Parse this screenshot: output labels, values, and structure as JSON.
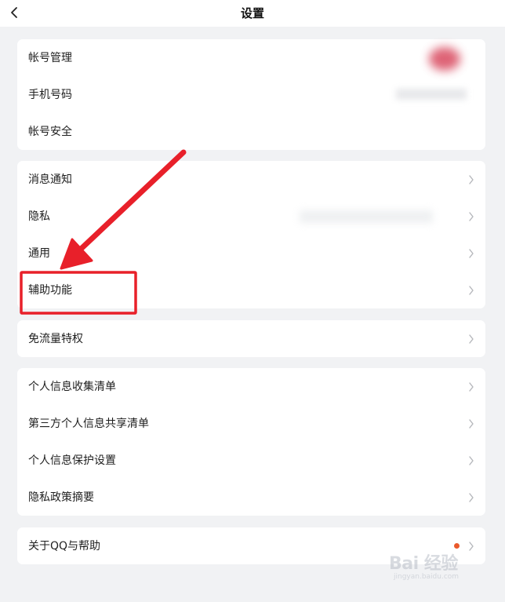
{
  "header": {
    "title": "设置"
  },
  "groups": {
    "account": {
      "items": [
        {
          "label": "帐号管理"
        },
        {
          "label": "手机号码"
        },
        {
          "label": "帐号安全"
        }
      ]
    },
    "general": {
      "items": [
        {
          "label": "消息通知"
        },
        {
          "label": "隐私"
        },
        {
          "label": "通用"
        },
        {
          "label": "辅助功能"
        }
      ]
    },
    "data_plan": {
      "items": [
        {
          "label": "免流量特权"
        }
      ]
    },
    "privacy_info": {
      "items": [
        {
          "label": "个人信息收集清单"
        },
        {
          "label": "第三方个人信息共享清单"
        },
        {
          "label": "个人信息保护设置"
        },
        {
          "label": "隐私政策摘要"
        }
      ]
    },
    "about": {
      "items": [
        {
          "label": "关于QQ与帮助"
        }
      ]
    }
  },
  "annotation": {
    "arrow_color": "#e8202a",
    "highlight_target": "辅助功能"
  },
  "watermark": {
    "main": "Bai 经验",
    "sub": "jingyan.baidu.com"
  },
  "colors": {
    "background": "#f1f2f4",
    "card": "#ffffff",
    "notification_dot": "#ea5a2c",
    "chevron": "#b5b7bb"
  }
}
